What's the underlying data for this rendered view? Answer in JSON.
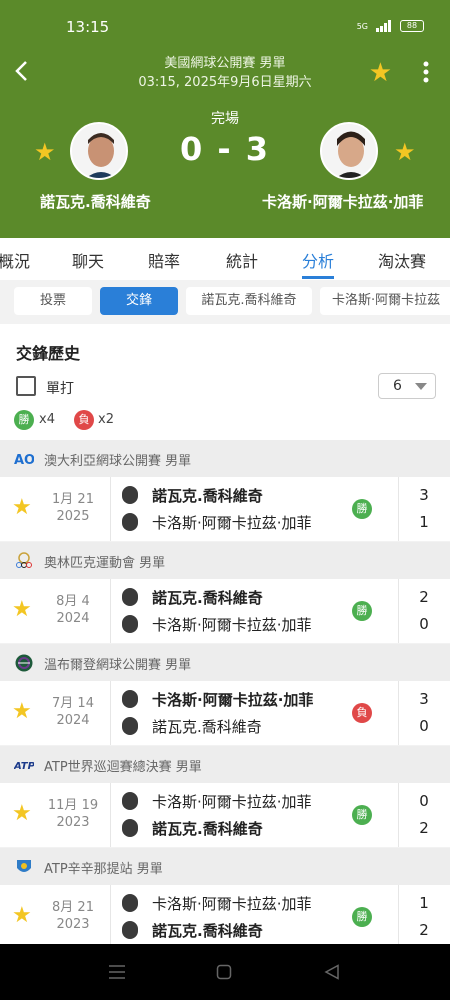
{
  "status_bar": {
    "time": "13:15",
    "network": "5G",
    "battery": "88"
  },
  "header": {
    "tournament": "美國網球公開賽 男單",
    "datetime": "03:15, 2025年9月6日星期六",
    "status": "完場",
    "score": "0 - 3",
    "player1": "諾瓦克.喬科維奇",
    "player2": "卡洛斯·阿爾卡拉茲·加菲"
  },
  "tabs": [
    "概況",
    "聊天",
    "賠率",
    "統計",
    "分析",
    "淘汰賽"
  ],
  "active_tab": "分析",
  "chips": [
    "投票",
    "交鋒",
    "諾瓦克.喬科維奇",
    "卡洛斯·阿爾卡拉茲"
  ],
  "active_chip": "交鋒",
  "h2h": {
    "title": "交鋒歷史",
    "filter_label": "單打",
    "count_select": "6",
    "win_label": "勝",
    "loss_label": "負",
    "wins": "x4",
    "losses": "x2"
  },
  "matches": [
    {
      "tournament": "澳大利亞網球公開賽 男單",
      "date": "1月 21",
      "year": "2025",
      "top": "諾瓦克.喬科維奇",
      "bottom": "卡洛斯·阿爾卡拉茲·加菲",
      "top_bold": true,
      "bottom_bold": false,
      "result": "勝",
      "top_score": "3",
      "bottom_score": "1"
    },
    {
      "tournament": "奧林匹克運動會 男單",
      "date": "8月 4",
      "year": "2024",
      "top": "諾瓦克.喬科維奇",
      "bottom": "卡洛斯·阿爾卡拉茲·加菲",
      "top_bold": true,
      "bottom_bold": false,
      "result": "勝",
      "top_score": "2",
      "bottom_score": "0"
    },
    {
      "tournament": "溫布爾登網球公開賽 男單",
      "date": "7月 14",
      "year": "2024",
      "top": "卡洛斯·阿爾卡拉茲·加菲",
      "bottom": "諾瓦克.喬科維奇",
      "top_bold": true,
      "bottom_bold": false,
      "result": "負",
      "top_score": "3",
      "bottom_score": "0"
    },
    {
      "tournament": "ATP世界巡迴賽總決賽 男單",
      "date": "11月 19",
      "year": "2023",
      "top": "卡洛斯·阿爾卡拉茲·加菲",
      "bottom": "諾瓦克.喬科維奇",
      "top_bold": false,
      "bottom_bold": true,
      "result": "勝",
      "top_score": "0",
      "bottom_score": "2"
    },
    {
      "tournament": "ATP辛辛那提站 男單",
      "date": "8月 21",
      "year": "2023",
      "top": "卡洛斯·阿爾卡拉茲·加菲",
      "bottom": "諾瓦克.喬科維奇",
      "top_bold": false,
      "bottom_bold": true,
      "result": "勝",
      "top_score": "1",
      "bottom_score": "2"
    }
  ],
  "colors": {
    "header_bg": "#5b8a2a",
    "accent": "#2a7fd8",
    "win": "#4caf50",
    "loss": "#e04848",
    "star": "#f3c623"
  }
}
